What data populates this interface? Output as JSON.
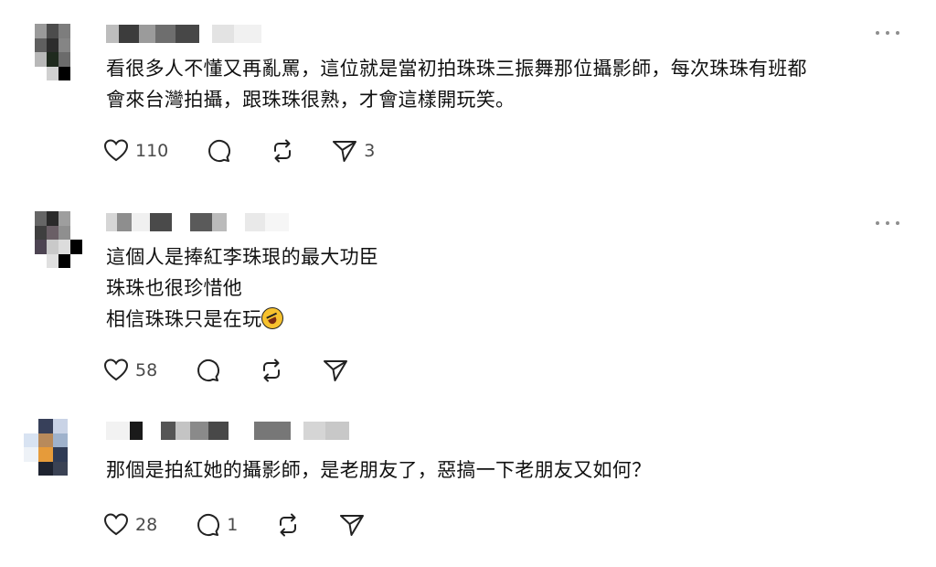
{
  "comments": [
    {
      "text": "看很多人不懂又再亂罵，這位就是當初拍珠珠三振舞那位攝影師，每次珠珠有班都\n會來台灣拍攝，跟珠珠很熟，才會這樣開玩笑。",
      "likes": "110",
      "replies": "",
      "reposts": "",
      "shares": "3",
      "has_more_menu": true
    },
    {
      "text": "這個人是捧紅李珠珢的最大功臣\n珠珠也很珍惜他\n相信珠珠只是在玩",
      "likes": "58",
      "replies": "",
      "reposts": "",
      "shares": "",
      "has_more_menu": true,
      "trailing_emoji": "rolling-on-floor-laughing"
    },
    {
      "text": "那個是拍紅她的攝影師，是老朋友了，惡搞一下老朋友又如何？",
      "likes": "28",
      "replies": "1",
      "reposts": "",
      "shares": "",
      "has_more_menu": false
    }
  ],
  "icons": {
    "like": "heart-icon",
    "reply": "comment-bubble-icon",
    "repost": "repost-icon",
    "share": "send-icon",
    "more": "more-dots-icon"
  },
  "colors": {
    "text": "#111111",
    "icon": "#222222",
    "count": "#4a4a4a",
    "muted": "#8e8e8e"
  }
}
